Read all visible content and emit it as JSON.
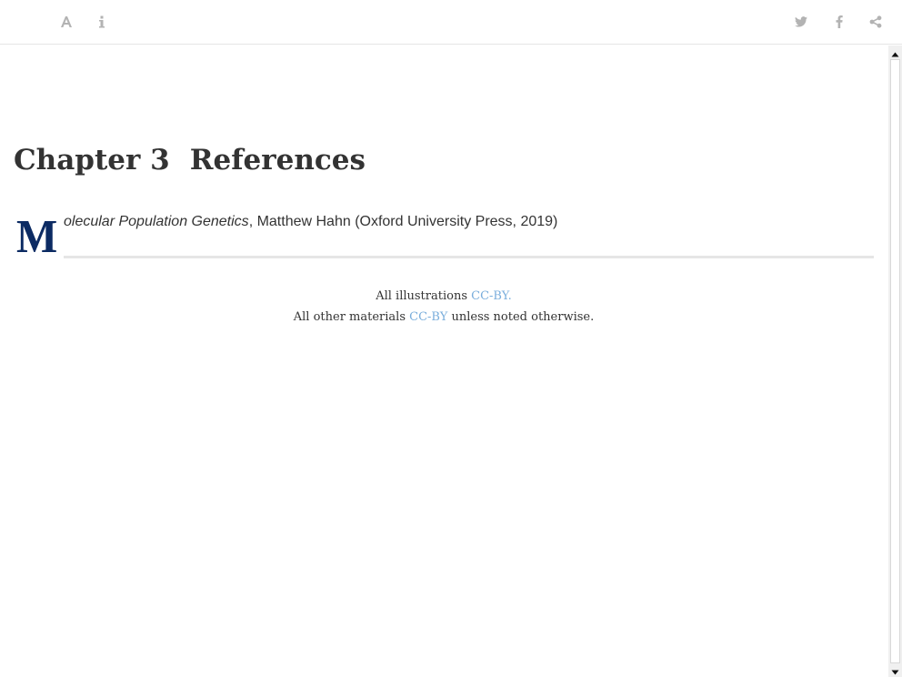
{
  "toolbar": {
    "left_buttons": [
      {
        "icon": "font-settings-icon",
        "label": "A"
      },
      {
        "icon": "info-icon",
        "label": "i"
      }
    ],
    "right_buttons": [
      {
        "icon": "twitter-icon"
      },
      {
        "icon": "facebook-icon"
      },
      {
        "icon": "share-icon"
      }
    ],
    "icon_color": "#b3b3b3"
  },
  "chapter": {
    "number": "Chapter 3",
    "title": "References"
  },
  "reference": {
    "drop_cap": "M",
    "italic_title_rest": "olecular Population Genetics",
    "details": ", Matthew Hahn (Oxford University Press, 2019)"
  },
  "footer": {
    "line1_prefix": "All illustrations ",
    "line1_link": "CC-BY.",
    "line2_prefix": "All other materials ",
    "line2_link": "CC-BY",
    "line2_suffix": " unless noted otherwise."
  },
  "colors": {
    "drop_cap": "#0c2b63",
    "link": "#7aaedc",
    "text": "#333333"
  }
}
